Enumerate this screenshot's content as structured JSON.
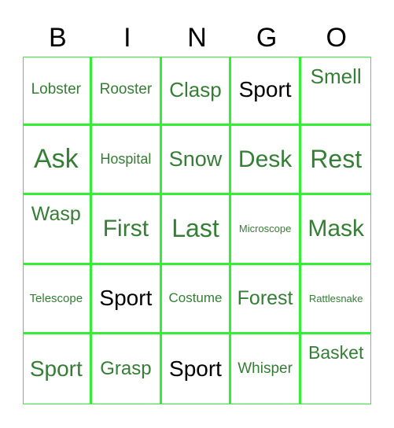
{
  "header": [
    "B",
    "I",
    "N",
    "G",
    "O"
  ],
  "cells": [
    [
      {
        "text": "Lobster",
        "size": 19,
        "color": "#357e35"
      },
      {
        "text": "Rooster",
        "size": 19,
        "color": "#357e35"
      },
      {
        "text": "Clasp",
        "size": 26,
        "color": "#357e35"
      },
      {
        "text": "Sport",
        "size": 28,
        "color": "#000000"
      },
      {
        "text": "Smell",
        "size": 26,
        "color": "#357e35",
        "top": true
      }
    ],
    [
      {
        "text": "Ask",
        "size": 34,
        "color": "#357e35"
      },
      {
        "text": "Hospital",
        "size": 18,
        "color": "#357e35"
      },
      {
        "text": "Snow",
        "size": 27,
        "color": "#357e35"
      },
      {
        "text": "Desk",
        "size": 30,
        "color": "#357e35"
      },
      {
        "text": "Rest",
        "size": 32,
        "color": "#357e35"
      }
    ],
    [
      {
        "text": "Wasp",
        "size": 25,
        "color": "#357e35",
        "top": true
      },
      {
        "text": "First",
        "size": 30,
        "color": "#357e35"
      },
      {
        "text": "Last",
        "size": 32,
        "color": "#357e35"
      },
      {
        "text": "Microscope",
        "size": 13,
        "color": "#357e35"
      },
      {
        "text": "Mask",
        "size": 30,
        "color": "#357e35"
      }
    ],
    [
      {
        "text": "Telescope",
        "size": 15,
        "color": "#357e35"
      },
      {
        "text": "Sport",
        "size": 28,
        "color": "#000000"
      },
      {
        "text": "Costume",
        "size": 17,
        "color": "#357e35"
      },
      {
        "text": "Forest",
        "size": 25,
        "color": "#357e35"
      },
      {
        "text": "Rattlesnake",
        "size": 13,
        "color": "#357e35"
      }
    ],
    [
      {
        "text": "Sport",
        "size": 28,
        "color": "#357e35"
      },
      {
        "text": "Grasp",
        "size": 24,
        "color": "#357e35"
      },
      {
        "text": "Sport",
        "size": 28,
        "color": "#000000"
      },
      {
        "text": "Whisper",
        "size": 19,
        "color": "#357e35"
      },
      {
        "text": "Basket",
        "size": 23,
        "color": "#357e35",
        "top": true
      }
    ]
  ],
  "colors": {
    "border": "#33ee33",
    "text": "#357e35",
    "header": "#000000"
  }
}
